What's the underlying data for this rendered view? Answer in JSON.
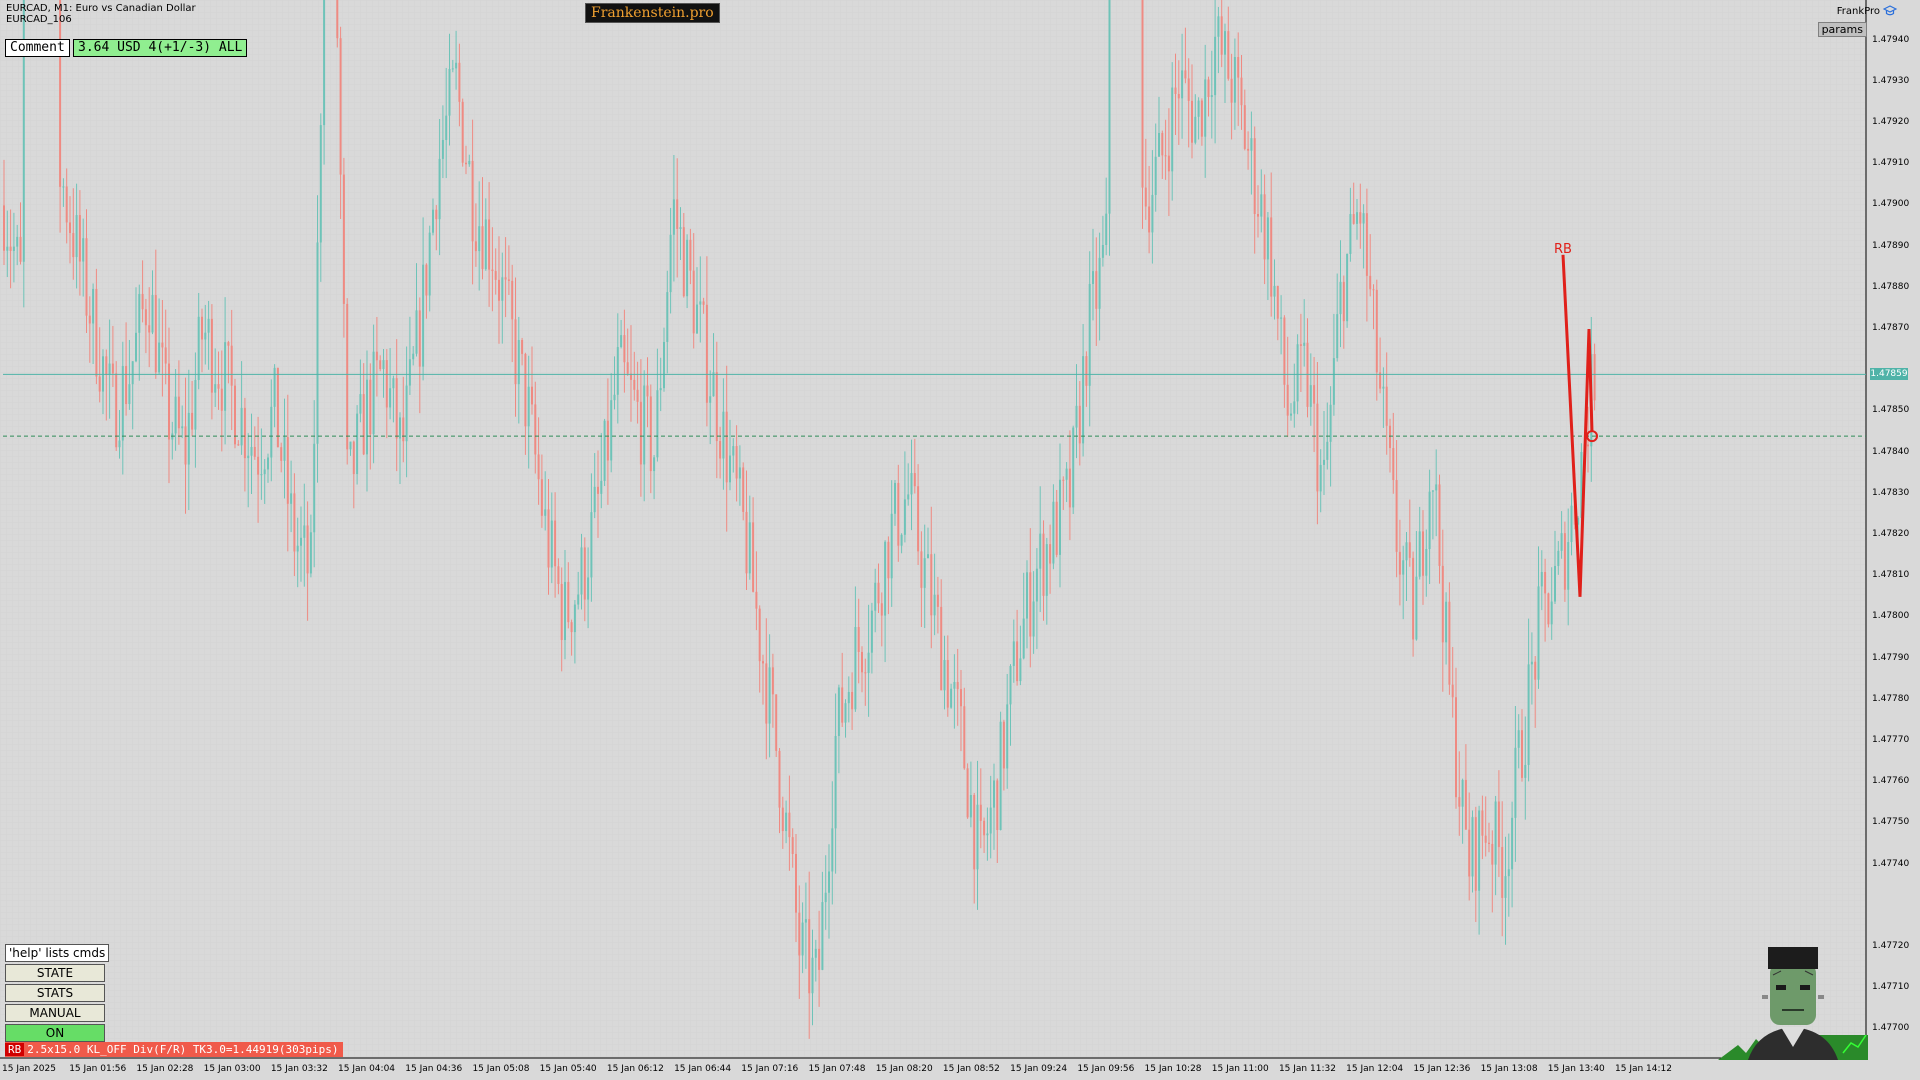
{
  "header": {
    "symbol_line": "EURCAD, M1:  Euro vs Canadian Dollar",
    "account_line": "EURCAD_106"
  },
  "brand": "Frankenstein.pro",
  "comment": {
    "label": "Comment",
    "value": "3.64 USD 4(+1/-3) ALL"
  },
  "top_right": {
    "frankpro": "FrankPro",
    "params": "params"
  },
  "controls": {
    "help": "'help' lists cmds",
    "buttons": [
      "STATE",
      "STATS",
      "MANUAL",
      "ON"
    ]
  },
  "status_bar": {
    "tag": "RB",
    "text": "2.5x15.0 KL_OFF Div(F/R) TK3.0=1.44919(303pips)"
  },
  "chart_data": {
    "type": "candlestick",
    "symbol": "EURCAD",
    "timeframe": "M1",
    "current_price": "1.47859",
    "ylim": [
      1.47695,
      1.47945
    ],
    "y_ticks": [
      "1.47940",
      "1.47930",
      "1.47920",
      "1.47910",
      "1.47900",
      "1.47890",
      "1.47880",
      "1.47870",
      "1.47850",
      "1.47840",
      "1.47830",
      "1.47820",
      "1.47810",
      "1.47800",
      "1.47790",
      "1.47780",
      "1.47770",
      "1.47760",
      "1.47750",
      "1.47740",
      "1.47720",
      "1.47710",
      "1.47700"
    ],
    "x_ticks": [
      "15 Jan 2025",
      "15 Jan 01:56",
      "15 Jan 02:28",
      "15 Jan 03:00",
      "15 Jan 03:32",
      "15 Jan 04:04",
      "15 Jan 04:36",
      "15 Jan 05:08",
      "15 Jan 05:40",
      "15 Jan 06:12",
      "15 Jan 06:44",
      "15 Jan 07:16",
      "15 Jan 07:48",
      "15 Jan 08:20",
      "15 Jan 08:52",
      "15 Jan 09:24",
      "15 Jan 09:56",
      "15 Jan 10:28",
      "15 Jan 11:00",
      "15 Jan 11:32",
      "15 Jan 12:04",
      "15 Jan 12:36",
      "15 Jan 13:08",
      "15 Jan 13:40",
      "15 Jan 14:12"
    ],
    "path_points": [
      1.479,
      1.4788,
      1.4885,
      1.4791,
      1.4789,
      1.4787,
      1.4785,
      1.4786,
      1.4788,
      1.4785,
      1.4784,
      1.4787,
      1.4786,
      1.4785,
      1.4784,
      1.4785,
      1.4782,
      1.4781,
      1.4803,
      1.4783,
      1.4785,
      1.4786,
      1.4784,
      1.4787,
      1.4791,
      1.4793,
      1.479,
      1.4789,
      1.4787,
      1.4785,
      1.4782,
      1.478,
      1.4781,
      1.4783,
      1.4786,
      1.4785,
      1.4784,
      1.479,
      1.4788,
      1.4786,
      1.4784,
      1.4782,
      1.4779,
      1.4776,
      1.4772,
      1.4771,
      1.4777,
      1.4779,
      1.478,
      1.4782,
      1.4783,
      1.4781,
      1.4779,
      1.4777,
      1.4774,
      1.4776,
      1.4779,
      1.4781,
      1.4782,
      1.4783,
      1.4787,
      1.4789,
      1.4885,
      1.479,
      1.4791,
      1.4793,
      1.4792,
      1.4794,
      1.4793,
      1.4791,
      1.4789,
      1.4785,
      1.4786,
      1.4783,
      1.4788,
      1.479,
      1.4786,
      1.4782,
      1.478,
      1.4784,
      1.4778,
      1.4774,
      1.4775,
      1.4774,
      1.4777,
      1.478,
      1.4781,
      1.4783,
      1.4786
    ],
    "levels": [
      {
        "value": 1.47859,
        "style": "solid",
        "color": "#4fb3a8"
      },
      {
        "value": 1.47844,
        "style": "dashed",
        "color": "#2e8b57"
      }
    ],
    "annotations": [
      {
        "text": "RB",
        "color": "#e0201a"
      }
    ],
    "colors": {
      "bull": "#6ec3b8",
      "bear": "#ef8a82",
      "signal": "#e0201a",
      "background": "#d9d9d9"
    }
  }
}
